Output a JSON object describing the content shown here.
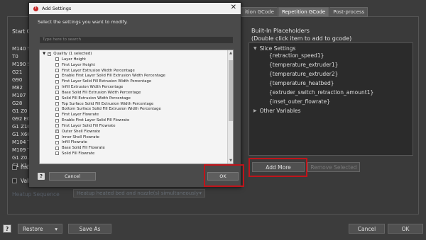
{
  "background": {
    "tabs": [
      "ition GCode",
      "Repetition GCode",
      "Post-process"
    ],
    "start_gcode_label": "Start GC",
    "gcode_lines": [
      "M140 S{",
      "T0",
      "M190 S{",
      "G21",
      "G90",
      "M82",
      "M107",
      "G28",
      "G1 Z0 F",
      "G92 E0",
      "G1 Z10 F",
      "G1 X60 Y",
      "M104 T0",
      "M109 T0",
      "G1 Z0.2",
      "G1 X140"
    ],
    "insert_label": "Inser",
    "validate_label": "Valida",
    "heatup_label": "Heatup Sequence",
    "heatup_value": "Heatup heated bed and nozzle(s) simultaneously",
    "builtin_title": "Built-In Placeholders",
    "builtin_subtitle": "(Double click item to add to gcode)",
    "slice_settings_label": "Slice Settings",
    "placeholders": [
      "{retraction_speed1}",
      "{temperature_extruder1}",
      "{temperature_extruder2}",
      "{temperature_heatbed}",
      "{extruder_switch_retraction_amount1}",
      "{inset_outer_flowrate}"
    ],
    "other_variables_label": "Other Variables",
    "add_more_label": "Add More",
    "remove_selected_label": "Remove Selected",
    "bottom": {
      "help": "?",
      "restore_label": "Restore",
      "save_as_label": "Save As",
      "cancel_label": "Cancel",
      "ok_label": "OK"
    }
  },
  "dialog": {
    "title": "Add Settings",
    "subtitle": "Select the settings you want to modify.",
    "search_placeholder": "Type here to search",
    "group_label": "Quality (1 selected)",
    "items": [
      {
        "label": "Layer Height",
        "checked": false
      },
      {
        "label": "First Layer Height",
        "checked": false
      },
      {
        "label": "First Layer Extrusion Width Percentage",
        "checked": false
      },
      {
        "label": "Enable First Layer Solid Fill Extrusion Width Percentage",
        "checked": false
      },
      {
        "label": "First Layer Solid Fill Extrusion Width Percentage",
        "checked": false
      },
      {
        "label": "Infill Extrusion Width Percentage",
        "checked": false
      },
      {
        "label": "Base Solid Fill Extrusion Width Percentage",
        "checked": false
      },
      {
        "label": "Solid Fill Extrusion Width Percentage",
        "checked": false
      },
      {
        "label": "Top Surface Solid Fill Extrusion Width Percentage",
        "checked": false
      },
      {
        "label": "Bottom Surface Solid Fill Extrusion Width Percentage",
        "checked": false
      },
      {
        "label": "First Layer Flowrate",
        "checked": false
      },
      {
        "label": "Enable First Layer Solid Fill Flowrate",
        "checked": false
      },
      {
        "label": "First Layer Solid Fill Flowrate",
        "checked": false
      },
      {
        "label": "Outer Shell Flowrate",
        "checked": true
      },
      {
        "label": "Inner Shell Flowrate",
        "checked": false
      },
      {
        "label": "Infill Flowrate",
        "checked": false
      },
      {
        "label": "Base Solid Fill Flowrate",
        "checked": false
      },
      {
        "label": "Solid Fill Flowrate",
        "checked": false
      }
    ],
    "help": "?",
    "cancel_label": "Cancel",
    "ok_label": "OK"
  },
  "colors": {
    "highlight": "#c0141a"
  }
}
